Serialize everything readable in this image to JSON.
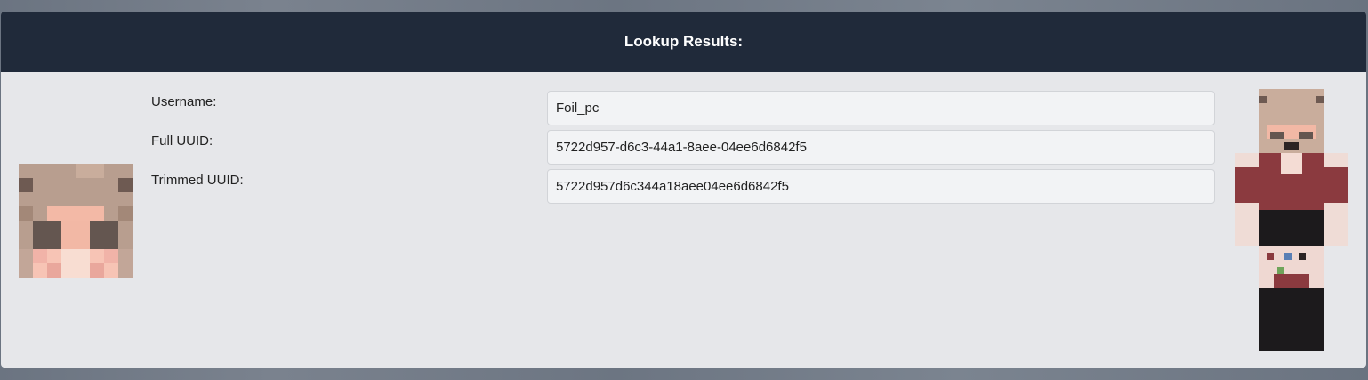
{
  "header": {
    "title": "Lookup Results:"
  },
  "fields": [
    {
      "label": "Username:",
      "value": "Foil_pc"
    },
    {
      "label": "Full UUID:",
      "value": "5722d957-d6c3-44a1-8aee-04ee6d6842f5"
    },
    {
      "label": "Trimmed UUID:",
      "value": "5722d957d6c344a18aee04ee6d6842f5"
    }
  ],
  "images": {
    "head": "player-head-avatar",
    "body": "player-skin-body"
  }
}
